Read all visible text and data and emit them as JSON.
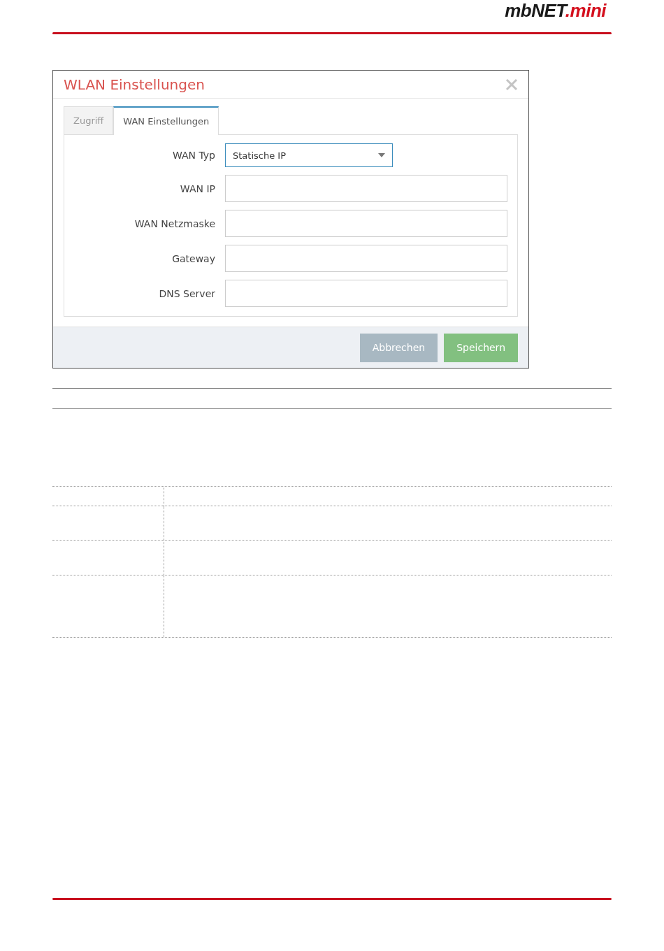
{
  "logo": {
    "main": "mbNET",
    "accent": ".mini"
  },
  "dialog": {
    "title": "WLAN Einstellungen",
    "tabs": [
      {
        "label": "Zugriff",
        "selected": false
      },
      {
        "label": "WAN Einstellungen",
        "selected": true
      }
    ],
    "fields": [
      {
        "label": "WAN Typ",
        "kind": "select",
        "value": "Statische IP"
      },
      {
        "label": "WAN IP",
        "kind": "input"
      },
      {
        "label": "WAN Netzmaske",
        "kind": "input"
      },
      {
        "label": "Gateway",
        "kind": "input"
      },
      {
        "label": "DNS Server",
        "kind": "input"
      }
    ],
    "buttons": [
      {
        "label": "Abbrechen",
        "kind": "cancel"
      },
      {
        "label": "Speichern",
        "kind": "save"
      }
    ]
  }
}
